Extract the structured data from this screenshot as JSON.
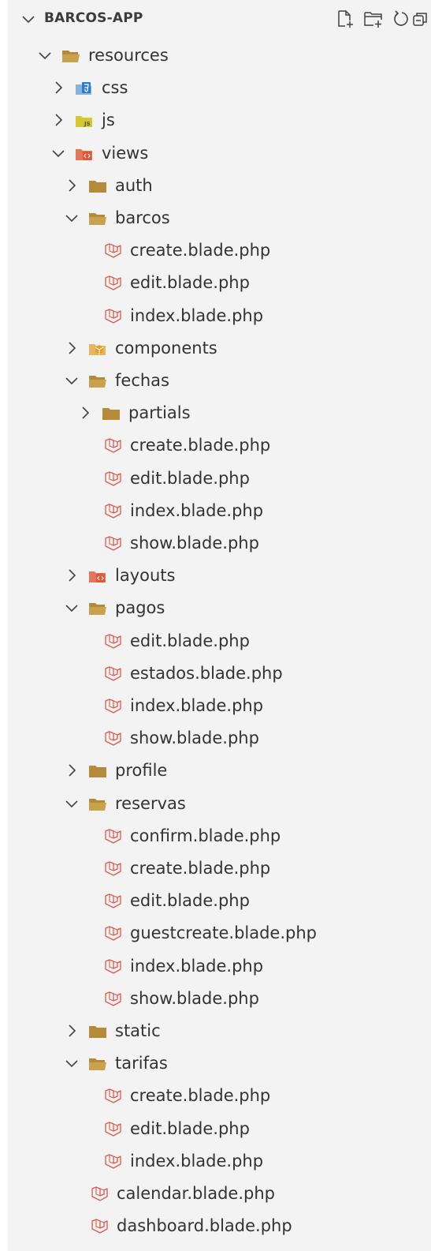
{
  "explorer": {
    "title": "BARCOS-APP",
    "actions": [
      "new-file-icon",
      "new-folder-icon",
      "refresh-icon",
      "collapse-all-icon"
    ],
    "items": [
      {
        "label": "resources",
        "depth": 0,
        "kind": "folder",
        "expanded": true
      },
      {
        "label": "css",
        "depth": 1,
        "kind": "css",
        "expanded": false
      },
      {
        "label": "js",
        "depth": 1,
        "kind": "js",
        "expanded": false
      },
      {
        "label": "views",
        "depth": 1,
        "kind": "views",
        "expanded": true
      },
      {
        "label": "auth",
        "depth": 2,
        "kind": "folder",
        "expanded": false
      },
      {
        "label": "barcos",
        "depth": 2,
        "kind": "folder",
        "expanded": true
      },
      {
        "label": "create.blade.php",
        "depth": 3,
        "kind": "blade"
      },
      {
        "label": "edit.blade.php",
        "depth": 3,
        "kind": "blade"
      },
      {
        "label": "index.blade.php",
        "depth": 3,
        "kind": "blade"
      },
      {
        "label": "components",
        "depth": 2,
        "kind": "components",
        "expanded": false
      },
      {
        "label": "fechas",
        "depth": 2,
        "kind": "folder",
        "expanded": true
      },
      {
        "label": "partials",
        "depth": 3,
        "kind": "folder",
        "expanded": false
      },
      {
        "label": "create.blade.php",
        "depth": 3,
        "kind": "blade"
      },
      {
        "label": "edit.blade.php",
        "depth": 3,
        "kind": "blade"
      },
      {
        "label": "index.blade.php",
        "depth": 3,
        "kind": "blade"
      },
      {
        "label": "show.blade.php",
        "depth": 3,
        "kind": "blade"
      },
      {
        "label": "layouts",
        "depth": 2,
        "kind": "views",
        "expanded": false
      },
      {
        "label": "pagos",
        "depth": 2,
        "kind": "folder",
        "expanded": true
      },
      {
        "label": "edit.blade.php",
        "depth": 3,
        "kind": "blade"
      },
      {
        "label": "estados.blade.php",
        "depth": 3,
        "kind": "blade"
      },
      {
        "label": "index.blade.php",
        "depth": 3,
        "kind": "blade"
      },
      {
        "label": "show.blade.php",
        "depth": 3,
        "kind": "blade"
      },
      {
        "label": "profile",
        "depth": 2,
        "kind": "folder",
        "expanded": false
      },
      {
        "label": "reservas",
        "depth": 2,
        "kind": "folder",
        "expanded": true
      },
      {
        "label": "confirm.blade.php",
        "depth": 3,
        "kind": "blade"
      },
      {
        "label": "create.blade.php",
        "depth": 3,
        "kind": "blade"
      },
      {
        "label": "edit.blade.php",
        "depth": 3,
        "kind": "blade"
      },
      {
        "label": "guestcreate.blade.php",
        "depth": 3,
        "kind": "blade"
      },
      {
        "label": "index.blade.php",
        "depth": 3,
        "kind": "blade"
      },
      {
        "label": "show.blade.php",
        "depth": 3,
        "kind": "blade"
      },
      {
        "label": "static",
        "depth": 2,
        "kind": "folder",
        "expanded": false
      },
      {
        "label": "tarifas",
        "depth": 2,
        "kind": "folder",
        "expanded": true
      },
      {
        "label": "create.blade.php",
        "depth": 3,
        "kind": "blade"
      },
      {
        "label": "edit.blade.php",
        "depth": 3,
        "kind": "blade"
      },
      {
        "label": "index.blade.php",
        "depth": 3,
        "kind": "blade"
      },
      {
        "label": "calendar.blade.php",
        "depth": 2,
        "kind": "blade"
      },
      {
        "label": "dashboard.blade.php",
        "depth": 2,
        "kind": "blade"
      }
    ]
  },
  "colors": {
    "folder": "#b58b3a",
    "folder_open": "#c9a24e",
    "css": "#2a7ec9",
    "js": "#d6c730",
    "views": "#e05533",
    "components": "#e3a22a",
    "blade": "#e0594a",
    "chevron": "#424242"
  }
}
